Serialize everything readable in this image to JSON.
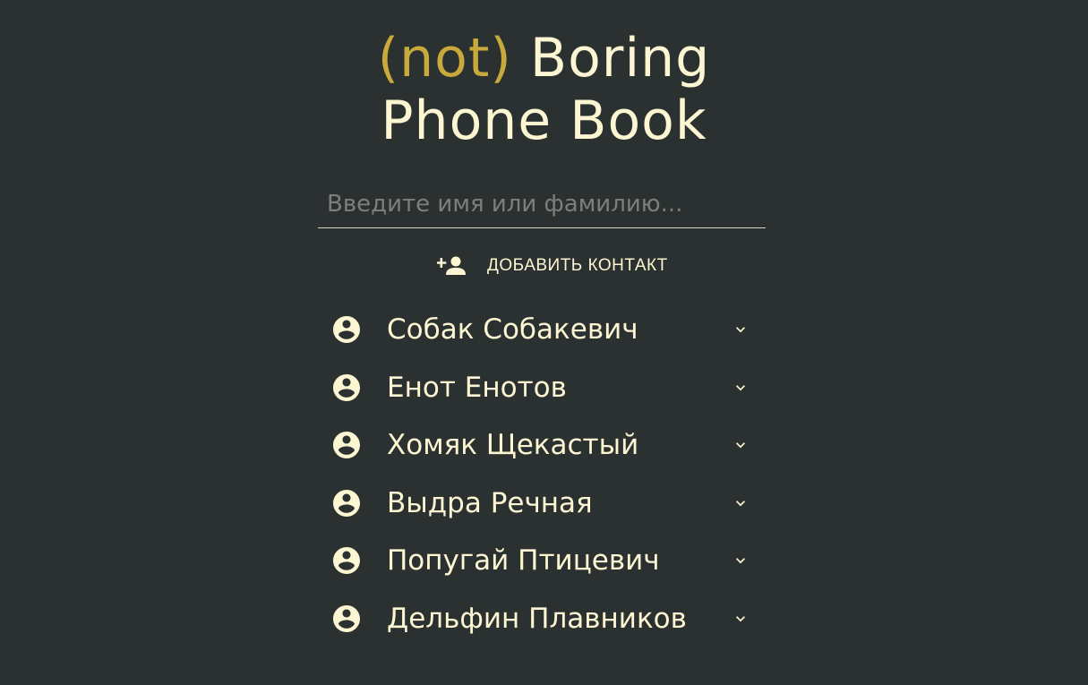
{
  "header": {
    "title_accent": "(not)",
    "title_rest": "Boring",
    "title_line2": "Phone Book"
  },
  "search": {
    "placeholder": "Введите имя или фамилию...",
    "value": ""
  },
  "add_contact": {
    "label": "ДОБАВИТЬ КОНТАКТ",
    "icon": "person-add-icon"
  },
  "contacts": [
    {
      "name": "Собак Собакевич",
      "icon": "account-circle-icon",
      "expand_icon": "chevron-down-icon"
    },
    {
      "name": "Енот Енотов",
      "icon": "account-circle-icon",
      "expand_icon": "chevron-down-icon"
    },
    {
      "name": "Хомяк Щекастый",
      "icon": "account-circle-icon",
      "expand_icon": "chevron-down-icon"
    },
    {
      "name": "Выдра Речная",
      "icon": "account-circle-icon",
      "expand_icon": "chevron-down-icon"
    },
    {
      "name": "Попугай Птицевич",
      "icon": "account-circle-icon",
      "expand_icon": "chevron-down-icon"
    },
    {
      "name": "Дельфин Плавников",
      "icon": "account-circle-icon",
      "expand_icon": "chevron-down-icon"
    }
  ],
  "colors": {
    "background": "#2b3030",
    "text": "#fdf6d3",
    "accent": "#c7a93c",
    "placeholder": "#7d7f7a"
  }
}
